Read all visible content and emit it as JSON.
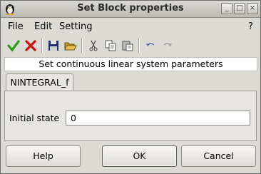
{
  "window": {
    "title": "Set Block properties",
    "controls": {
      "minimize": "_",
      "maximize": "□",
      "close": "×"
    }
  },
  "menubar": {
    "file": "File",
    "edit": "Edit",
    "setting": "Setting",
    "help": "?"
  },
  "toolbar": {
    "icons": [
      "check-icon",
      "cancel-x-icon",
      "save-icon",
      "open-folder-icon",
      "cut-icon",
      "copy-icon",
      "paste-icon",
      "undo-icon",
      "redo-icon"
    ]
  },
  "description": "Set continuous linear system parameters",
  "tab": {
    "label": "NINTEGRAL_f"
  },
  "form": {
    "initial_state_label": "Initial state",
    "initial_state_value": "0"
  },
  "buttons": {
    "help": "Help",
    "ok": "OK",
    "cancel": "Cancel"
  },
  "colors": {
    "check_green": "#2e9a1a",
    "cancel_red": "#cc1010"
  }
}
